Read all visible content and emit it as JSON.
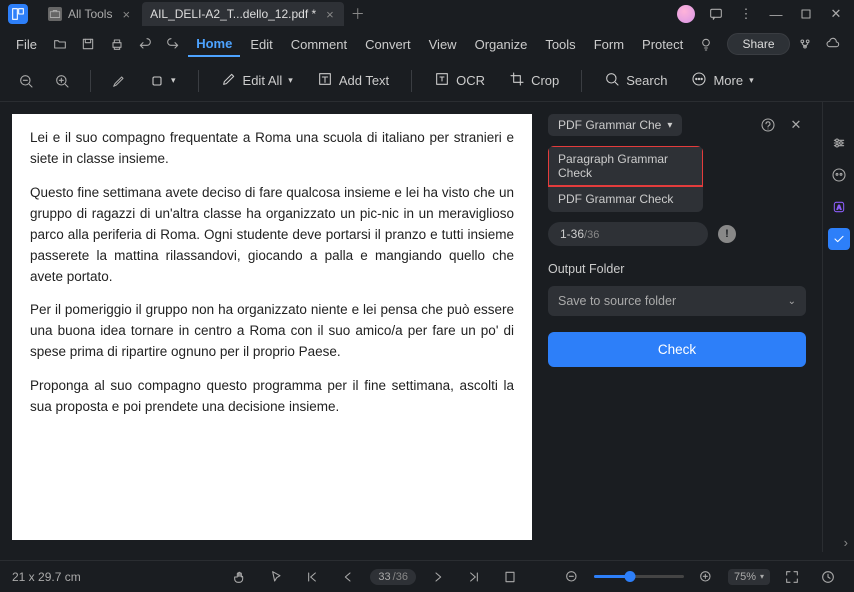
{
  "window": {
    "tabs": [
      {
        "label": "All Tools",
        "active": false
      },
      {
        "label": "AIL_DELI-A2_T...dello_12.pdf *",
        "active": true
      }
    ],
    "controls": {
      "min": "—",
      "max": "❐",
      "close": "✕",
      "more": "⋮"
    }
  },
  "menu": {
    "file": "File",
    "items": [
      "Home",
      "Edit",
      "Comment",
      "Convert",
      "View",
      "Organize",
      "Tools",
      "Form",
      "Protect"
    ],
    "active": "Home",
    "share": "Share"
  },
  "toolbar": {
    "edit_all": "Edit All",
    "add_text": "Add Text",
    "ocr": "OCR",
    "crop": "Crop",
    "search": "Search",
    "more": "More"
  },
  "document": {
    "paragraphs": [
      "Lei e il suo compagno frequentate a Roma una scuola di italiano per stranieri e siete in classe insieme.",
      "Questo fine settimana avete deciso di fare qualcosa insieme e lei ha visto che un gruppo di ragazzi di un'altra classe ha organizzato un pic-nic in un meraviglioso parco alla periferia di Roma. Ogni studente deve portarsi il pranzo e tutti insieme passerete la mattina rilassandovi, giocando a palla e mangiando quello che avete portato.",
      "Per il pomeriggio il gruppo non ha organizzato niente e lei pensa che può essere una buona idea tornare in centro a Roma con il suo amico/a per fare un po' di spese prima di ripartire ognuno per il proprio Paese.",
      "Proponga al suo compagno questo programma per il fine settimana, ascolti la sua proposta e poi prendete una decisione insieme."
    ]
  },
  "panel": {
    "title_short": "PDF Grammar Che",
    "options": [
      "Paragraph Grammar Check",
      "PDF Grammar Check"
    ],
    "pages_value": "1-36",
    "pages_total": "/36",
    "output_label": "Output Folder",
    "output_value": "Save to source folder",
    "check_btn": "Check"
  },
  "status": {
    "dims": "21 x 29.7 cm",
    "page_current": "33",
    "page_total": "/36",
    "zoom": "75%",
    "slider_percent": 40
  }
}
